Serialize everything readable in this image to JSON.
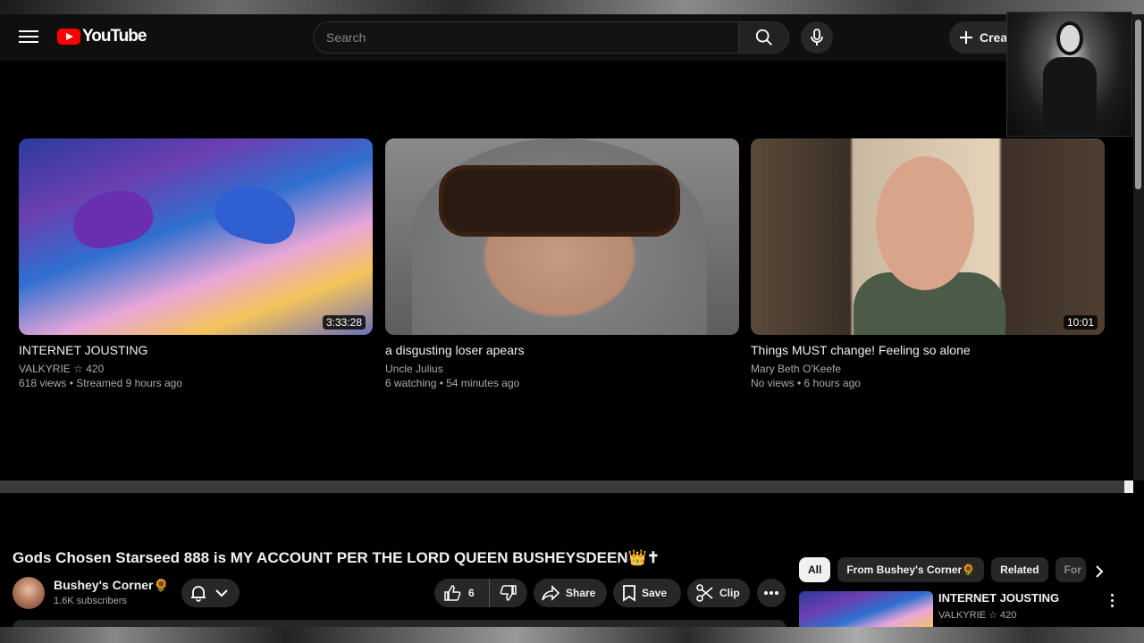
{
  "masthead": {
    "logo_text": "YouTube",
    "search_placeholder": "Search",
    "create_label": "Create"
  },
  "videos": [
    {
      "title": "INTERNET JOUSTING",
      "channel": "VALKYRIE ☆ 420",
      "stats": "618 views • Streamed 9 hours ago",
      "duration": "3:33:28"
    },
    {
      "title": "a disgusting loser apears",
      "channel": "Uncle Julius",
      "stats": "6 watching • 54 minutes ago",
      "duration": ""
    },
    {
      "title": "Things MUST change! Feeling so alone",
      "channel": "Mary Beth O'Keefe",
      "stats": "No views • 6 hours ago",
      "duration": "10:01"
    }
  ],
  "watch": {
    "title": "Gods Chosen Starseed 888 is MY ACCOUNT PER THE LORD QUEEN BUSHEYSDEEN👑✝",
    "channel_name": "Bushey's Corner🌻",
    "subscribers": "1.6K subscribers",
    "likes": "6",
    "share_label": "Share",
    "save_label": "Save",
    "clip_label": "Clip"
  },
  "chips": [
    "All",
    "From Bushey's Corner🌻",
    "Related",
    "For"
  ],
  "recommendation": {
    "title": "INTERNET JOUSTING",
    "channel": "VALKYRIE ☆ 420"
  },
  "colors": {
    "background": "#000000",
    "masthead": "#0f0f0f",
    "youtube_red": "#ff0000",
    "pill": "#272727",
    "secondary_text": "#aaaaaa"
  }
}
